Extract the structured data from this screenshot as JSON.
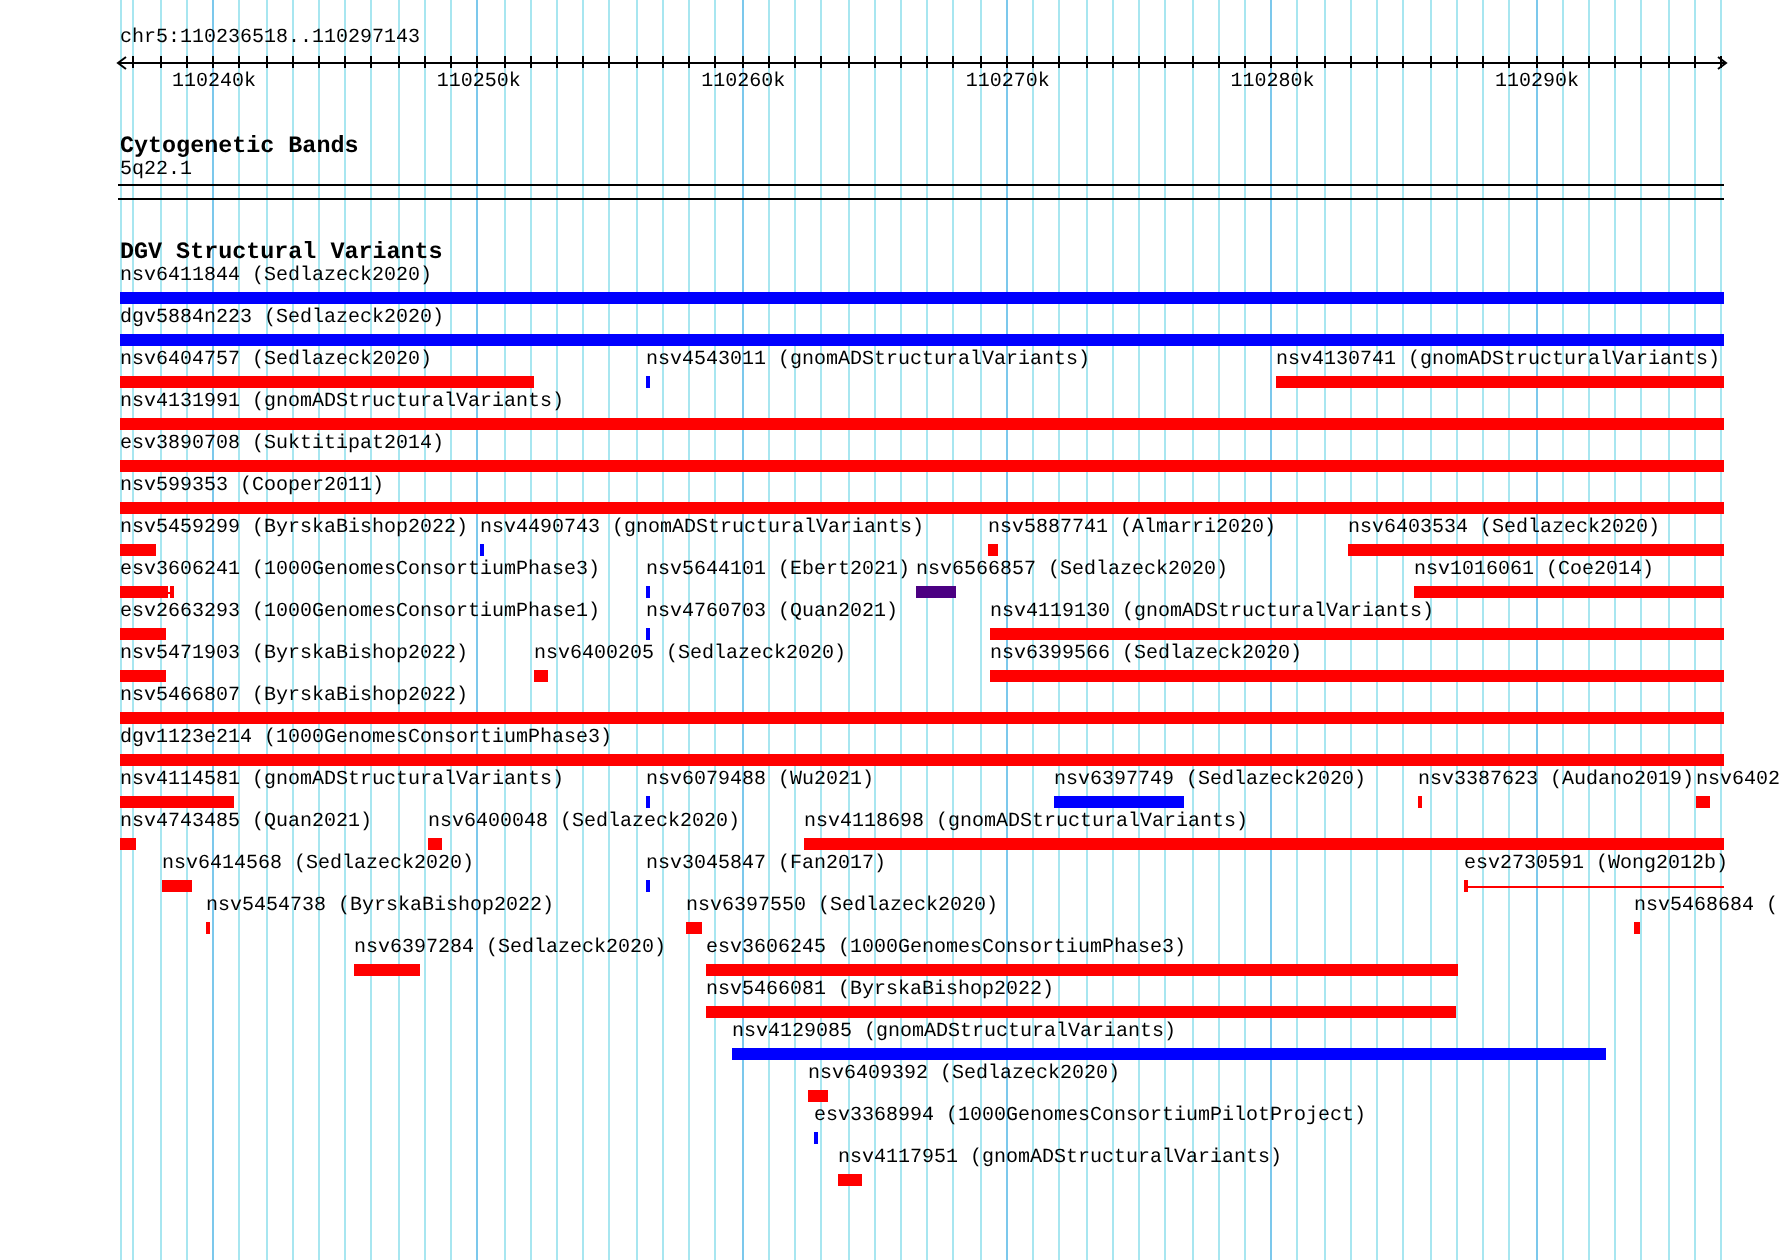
{
  "ruler": {
    "position": "chr5:110236518..110297143",
    "ticks": [
      {
        "label": "110240k"
      },
      {
        "label": "110250k"
      },
      {
        "label": "110260k"
      },
      {
        "label": "110270k"
      },
      {
        "label": "110280k"
      },
      {
        "label": "110290k"
      }
    ]
  },
  "tracks": [
    {
      "kind": "cytoband",
      "title": "Cytogenetic Bands",
      "band": "5q22.1"
    },
    {
      "kind": "features",
      "title": "DGV Structural Variants",
      "rows": [
        {
          "features": [
            {
              "kind": "block",
              "label": "nsv6411844 (Sedlazeck2020)",
              "color": "#0000ff"
            }
          ]
        },
        {
          "features": [
            {
              "kind": "block",
              "label": "dgv5884n223 (Sedlazeck2020)",
              "color": "#0000ff"
            }
          ]
        },
        {
          "features": [
            {
              "kind": "block",
              "label": "nsv6404757 (Sedlazeck2020)",
              "color": "#ff0000"
            },
            {
              "kind": "block",
              "label": "nsv4543011 (gnomADStructuralVariants)",
              "color": "#0000ff"
            },
            {
              "kind": "block",
              "label": "nsv4130741 (gnomADStructuralVariants)",
              "color": "#ff0000"
            }
          ]
        },
        {
          "features": [
            {
              "kind": "block",
              "label": "nsv4131991 (gnomADStructuralVariants)",
              "color": "#ff0000"
            }
          ]
        },
        {
          "features": [
            {
              "kind": "block",
              "label": "esv3890708 (Suktitipat2014)",
              "color": "#ff0000"
            }
          ]
        },
        {
          "features": [
            {
              "kind": "block",
              "label": "nsv599353 (Cooper2011)",
              "color": "#ff0000"
            }
          ]
        },
        {
          "features": [
            {
              "kind": "block",
              "label": "nsv5459299 (ByrskaBishop2022)",
              "color": "#ff0000"
            },
            {
              "kind": "block",
              "label": "nsv4490743 (gnomADStructuralVariants)",
              "color": "#0000ff"
            },
            {
              "kind": "block",
              "label": "nsv5887741 (Almarri2020)",
              "color": "#ff0000"
            },
            {
              "kind": "block",
              "label": "nsv6403534 (Sedlazeck2020)",
              "color": "#ff0000"
            }
          ]
        },
        {
          "features": [
            {
              "kind": "split",
              "label": "esv3606241 (1000GenomesConsortiumPhase3)",
              "color": "#ff0000"
            },
            {
              "kind": "block",
              "label": "nsv5644101 (Ebert2021)",
              "color": "#0000ff"
            },
            {
              "kind": "block",
              "label": "nsv6566857 (Sedlazeck2020)",
              "color": "#4b0082"
            },
            {
              "kind": "block",
              "label": "nsv1016061 (Coe2014)",
              "color": "#ff0000"
            }
          ]
        },
        {
          "features": [
            {
              "kind": "block",
              "label": "esv2663293 (1000GenomesConsortiumPhase1)",
              "color": "#ff0000"
            },
            {
              "kind": "block",
              "label": "nsv4760703 (Quan2021)",
              "color": "#0000ff"
            },
            {
              "kind": "block",
              "label": "nsv4119130 (gnomADStructuralVariants)",
              "color": "#ff0000"
            }
          ]
        },
        {
          "features": [
            {
              "kind": "block",
              "label": "nsv5471903 (ByrskaBishop2022)",
              "color": "#ff0000"
            },
            {
              "kind": "block",
              "label": "nsv6400205 (Sedlazeck2020)",
              "color": "#ff0000"
            },
            {
              "kind": "block",
              "label": "nsv6399566 (Sedlazeck2020)",
              "color": "#ff0000"
            }
          ]
        },
        {
          "features": [
            {
              "kind": "block",
              "label": "nsv5466807 (ByrskaBishop2022)",
              "color": "#ff0000"
            }
          ]
        },
        {
          "features": [
            {
              "kind": "block",
              "label": "dgv1123e214 (1000GenomesConsortiumPhase3)",
              "color": "#ff0000"
            }
          ]
        },
        {
          "features": [
            {
              "kind": "block",
              "label": "nsv4114581 (gnomADStructuralVariants)",
              "color": "#ff0000"
            },
            {
              "kind": "block",
              "label": "nsv6079488 (Wu2021)",
              "color": "#0000ff"
            },
            {
              "kind": "block",
              "label": "nsv6397749 (Sedlazeck2020)",
              "color": "#0000ff"
            },
            {
              "kind": "block",
              "label": "nsv3387623 (Audano2019)",
              "color": "#ff0000"
            },
            {
              "kind": "block",
              "label": "nsv6402",
              "color": "#ff0000"
            }
          ]
        },
        {
          "features": [
            {
              "kind": "block",
              "label": "nsv4743485 (Quan2021)",
              "color": "#ff0000"
            },
            {
              "kind": "block",
              "label": "nsv6400048 (Sedlazeck2020)",
              "color": "#ff0000"
            },
            {
              "kind": "block",
              "label": "nsv4118698 (gnomADStructuralVariants)",
              "color": "#ff0000"
            }
          ]
        },
        {
          "features": [
            {
              "kind": "block",
              "label": "nsv6414568 (Sedlazeck2020)",
              "color": "#ff0000"
            },
            {
              "kind": "block",
              "label": "nsv3045847 (Fan2017)",
              "color": "#0000ff"
            },
            {
              "kind": "split",
              "label": "esv2730591 (Wong2012b)",
              "color": "#ff0000"
            }
          ]
        },
        {
          "features": [
            {
              "kind": "block",
              "label": "nsv5454738 (ByrskaBishop2022)",
              "color": "#ff0000"
            },
            {
              "kind": "block",
              "label": "nsv6397550 (Sedlazeck2020)",
              "color": "#ff0000"
            },
            {
              "kind": "block",
              "label": "nsv5468684 (",
              "color": "#ff0000"
            }
          ]
        },
        {
          "features": [
            {
              "kind": "block",
              "label": "nsv6397284 (Sedlazeck2020)",
              "color": "#ff0000"
            },
            {
              "kind": "block",
              "label": "esv3606245 (1000GenomesConsortiumPhase3)",
              "color": "#ff0000"
            }
          ]
        },
        {
          "features": [
            {
              "kind": "block",
              "label": "nsv5466081 (ByrskaBishop2022)",
              "color": "#ff0000"
            }
          ]
        },
        {
          "features": [
            {
              "kind": "block",
              "label": "nsv4129085 (gnomADStructuralVariants)",
              "color": "#0000ff"
            }
          ]
        },
        {
          "features": [
            {
              "kind": "block",
              "label": "nsv6409392 (Sedlazeck2020)",
              "color": "#ff0000"
            }
          ]
        },
        {
          "features": [
            {
              "kind": "block",
              "label": "esv3368994 (1000GenomesConsortiumPilotProject)",
              "color": "#0000ff"
            }
          ]
        },
        {
          "features": [
            {
              "kind": "block",
              "label": "nsv4117951 (gnomADStructuralVariants)",
              "color": "#ff0000"
            }
          ]
        }
      ]
    }
  ]
}
